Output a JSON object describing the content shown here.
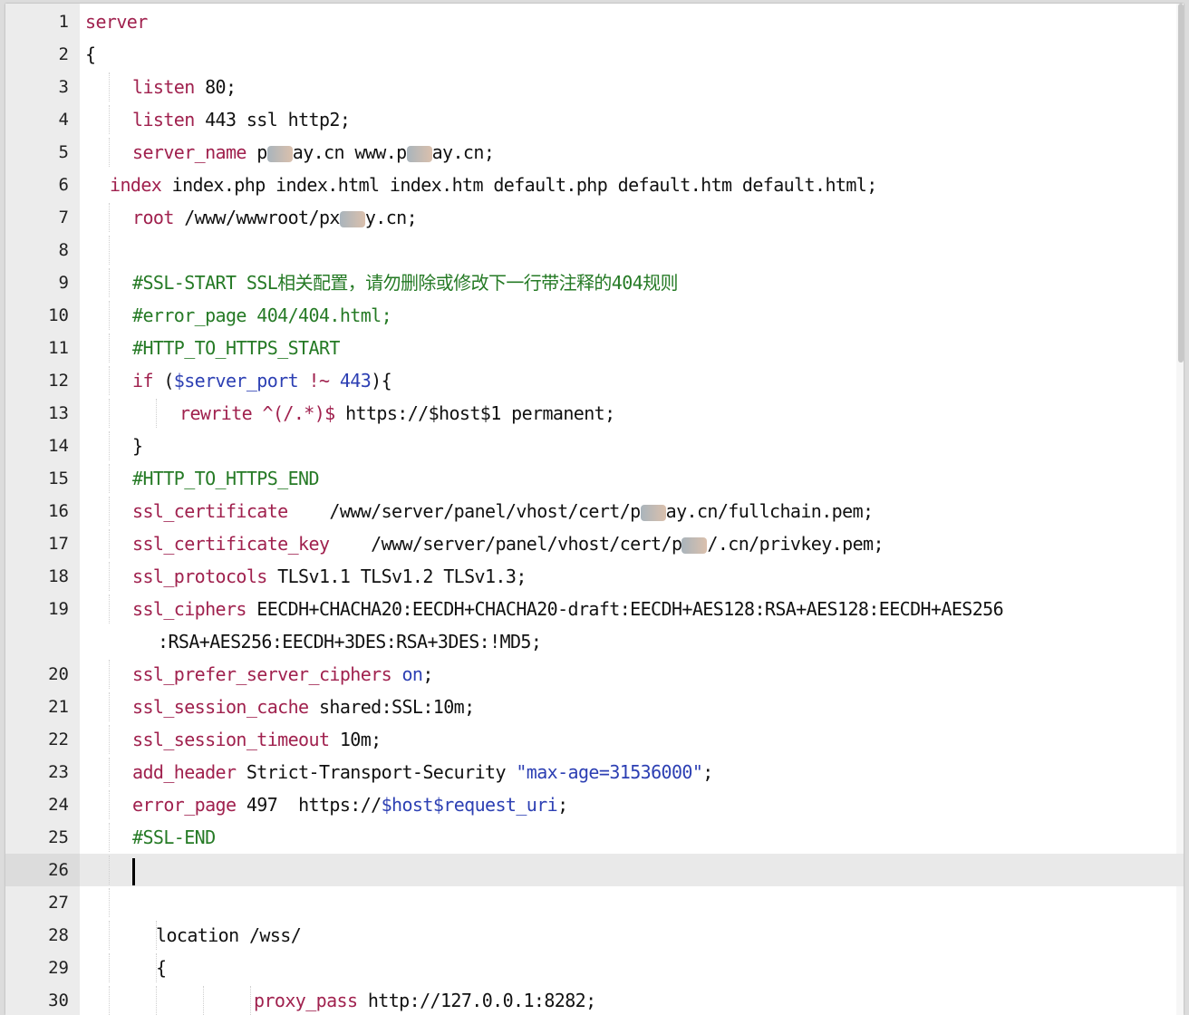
{
  "editor": {
    "lines": [
      {
        "n": "1",
        "t": "server"
      },
      {
        "n": "2",
        "t": "{"
      },
      {
        "n": "3",
        "a": "listen",
        "b": " 80;"
      },
      {
        "n": "4",
        "a": "listen",
        "b": " 443 ssl http2;"
      },
      {
        "n": "5",
        "a": "server_name",
        "b": " p",
        "c": "ay.cn www.p",
        "d": "ay.cn;"
      },
      {
        "n": "6",
        "a": "index",
        "b": " index.php index.html index.htm default.php default.htm default.html;"
      },
      {
        "n": "7",
        "a": "root",
        "b": " /www/wwwroot/px",
        "c": "y.cn;"
      },
      {
        "n": "8"
      },
      {
        "n": "9",
        "t": "#SSL-START SSL相关配置，请勿删除或修改下一行带注释的404规则"
      },
      {
        "n": "10",
        "t": "#error_page 404/404.html;"
      },
      {
        "n": "11",
        "t": "#HTTP_TO_HTTPS_START"
      },
      {
        "n": "12",
        "a": "if",
        "b": " (",
        "c": "$server_port",
        "d": " !~ ",
        "e": "443",
        "f": "){"
      },
      {
        "n": "13",
        "a": "rewrite",
        "b": " ^(/.*)$",
        "c": " https://$host$1 permanent;"
      },
      {
        "n": "14",
        "t": "}"
      },
      {
        "n": "15",
        "t": "#HTTP_TO_HTTPS_END"
      },
      {
        "n": "16",
        "a": "ssl_certificate",
        "b": "    /www/server/panel/vhost/cert/p",
        "c": "ay.cn/fullchain.pem;"
      },
      {
        "n": "17",
        "a": "ssl_certificate_key",
        "b": "    /www/server/panel/vhost/cert/p",
        "c": "/.cn/privkey.pem;"
      },
      {
        "n": "18",
        "a": "ssl_protocols",
        "b": " TLSv1.1 TLSv1.2 TLSv1.3;"
      },
      {
        "n": "19",
        "a": "ssl_ciphers",
        "b": " EECDH+CHACHA20:EECDH+CHACHA20-draft:EECDH+AES128:RSA+AES128:EECDH+AES256",
        "c": ":RSA+AES256:EECDH+3DES:RSA+3DES:!MD5;"
      },
      {
        "n": "20",
        "a": "ssl_prefer_server_ciphers",
        "b": " on",
        "c": ";"
      },
      {
        "n": "21",
        "a": "ssl_session_cache",
        "b": " shared:SSL:10m;"
      },
      {
        "n": "22",
        "a": "ssl_session_timeout",
        "b": " 10m;"
      },
      {
        "n": "23",
        "a": "add_header",
        "b": " Strict-Transport-Security ",
        "c": "\"max-age=31536000\"",
        "d": ";"
      },
      {
        "n": "24",
        "a": "error_page",
        "b": " 497  https://",
        "c": "$host$request_uri",
        "d": ";"
      },
      {
        "n": "25",
        "t": "#SSL-END"
      },
      {
        "n": "26"
      },
      {
        "n": "27"
      },
      {
        "n": "28",
        "t": "location /wss/"
      },
      {
        "n": "29",
        "t": "{"
      },
      {
        "n": "30",
        "a": "proxy_pass",
        "b": " http://127.0.0.1:8282;"
      }
    ]
  }
}
